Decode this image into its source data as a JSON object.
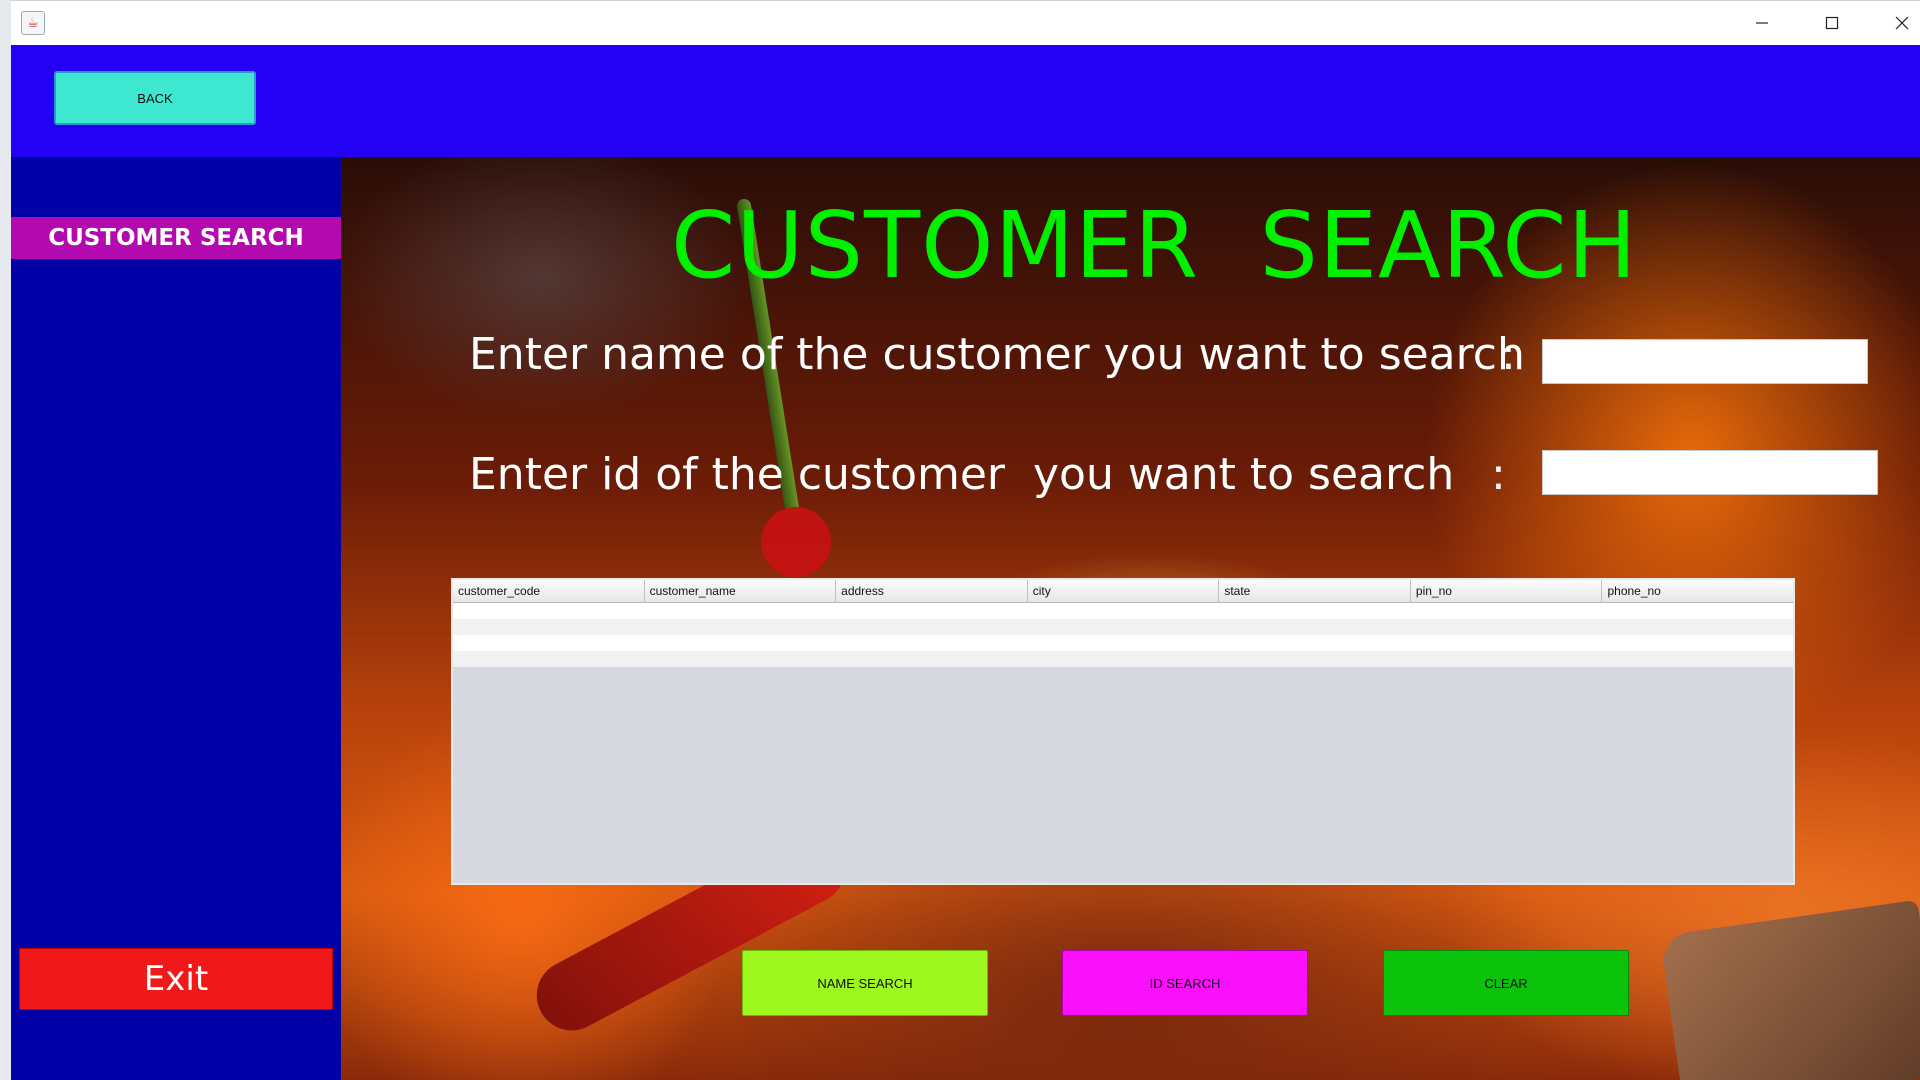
{
  "window": {
    "minimize_glyph": "—",
    "maximize_glyph": "☐",
    "close_glyph": "✕",
    "app_icon": "java-icon"
  },
  "topbar": {
    "back_label": "BACK",
    "color": "#2400f5"
  },
  "sidebar": {
    "active_item": "CUSTOMER SEARCH",
    "exit_label": "Exit",
    "color": "#0000a6",
    "active_color": "#b20aae"
  },
  "main": {
    "title": "CUSTOMER  SEARCH",
    "name_prompt": "Enter name of the customer you want to search",
    "id_prompt": "Enter id of the customer  you want to search",
    "colon": ":",
    "name_value": "",
    "id_value": "",
    "title_color": "#00f000"
  },
  "table": {
    "columns": [
      "customer_code",
      "customer_name",
      "address",
      "city",
      "state",
      "pin_no",
      "phone_no"
    ],
    "rows": []
  },
  "buttons": {
    "name_search": "NAME SEARCH",
    "id_search": "ID SEARCH",
    "clear": "CLEAR"
  }
}
